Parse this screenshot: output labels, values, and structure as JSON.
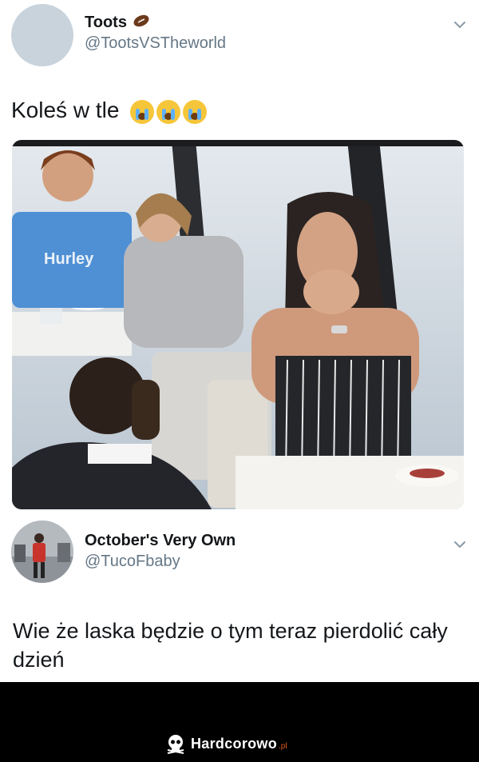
{
  "tweet1": {
    "name": "Toots",
    "handle": "@TootsVSTheworld",
    "text": "Koleś w tle",
    "emoji_count": 3,
    "emoji_name": "loudly-crying-face-icon"
  },
  "photo": {
    "shirt_text": "Hurley"
  },
  "tweet2": {
    "name": "October's Very Own",
    "handle": "@TucoFbaby",
    "text": "Wie że laska będzie o tym teraz pierdolić cały dzień"
  },
  "footer": {
    "brand": "Hardcorowo",
    "brand_tld": ".pl"
  },
  "colors": {
    "text": "#14171a",
    "handle": "#657786",
    "footer_bg": "#000000",
    "brand_accent": "#e05b1b"
  }
}
